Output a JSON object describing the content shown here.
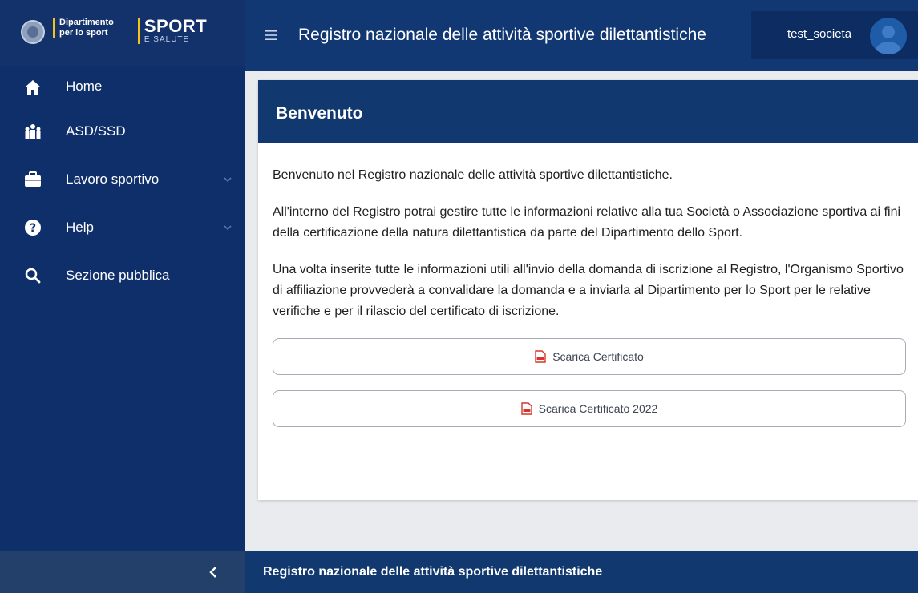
{
  "brand": {
    "dipartimento_line1": "Dipartimento",
    "dipartimento_line2": "per lo sport",
    "sport": "SPORT",
    "salute": "E SALUTE"
  },
  "header": {
    "title": "Registro nazionale delle attività sportive dilettantistiche",
    "username": "test_societa"
  },
  "sidebar": {
    "items": [
      {
        "label": "Home",
        "icon": "home-icon"
      },
      {
        "label": "ASD/SSD",
        "icon": "people-icon"
      },
      {
        "label": "Lavoro sportivo",
        "icon": "briefcase-icon",
        "expandable": true
      },
      {
        "label": "Help",
        "icon": "help-icon",
        "expandable": true
      },
      {
        "label": "Sezione pubblica",
        "icon": "search-icon"
      }
    ]
  },
  "card": {
    "title": "Benvenuto",
    "paragraphs": [
      "Benvenuto nel Registro nazionale delle attività sportive dilettantistiche.",
      "All'interno del Registro potrai gestire tutte le informazioni relative alla tua Società o Associazione sportiva ai fini della certificazione della natura dilettantistica da parte del Dipartimento dello Sport.",
      "Una volta inserite tutte le informazioni utili all'invio della domanda di iscrizione al Registro, l'Organismo Sportivo di affiliazione provvederà a convalidare la domanda e a inviarla al Dipartimento per lo Sport per le relative verifiche e per il rilascio del certificato di iscrizione."
    ],
    "buttons": [
      {
        "label": "Scarica Certificato",
        "icon": "pdf-icon"
      },
      {
        "label": "Scarica Certificato 2022",
        "icon": "pdf-icon"
      }
    ]
  },
  "footer": {
    "text": "Registro nazionale delle attività sportive dilettantistiche"
  },
  "colors": {
    "sidebar": "#0f2f6b",
    "header": "#123874",
    "accent_yellow": "#f6c21a",
    "pdf_red": "#d9342b"
  }
}
